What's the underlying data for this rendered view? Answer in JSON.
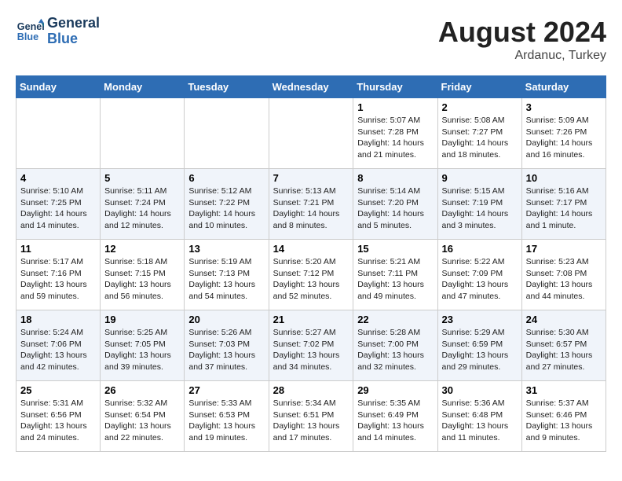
{
  "logo": {
    "line1": "General",
    "line2": "Blue"
  },
  "title": "August 2024",
  "subtitle": "Ardanuc, Turkey",
  "weekdays": [
    "Sunday",
    "Monday",
    "Tuesday",
    "Wednesday",
    "Thursday",
    "Friday",
    "Saturday"
  ],
  "weeks": [
    [
      {
        "day": "",
        "sunrise": "",
        "sunset": "",
        "daylight": ""
      },
      {
        "day": "",
        "sunrise": "",
        "sunset": "",
        "daylight": ""
      },
      {
        "day": "",
        "sunrise": "",
        "sunset": "",
        "daylight": ""
      },
      {
        "day": "",
        "sunrise": "",
        "sunset": "",
        "daylight": ""
      },
      {
        "day": "1",
        "sunrise": "Sunrise: 5:07 AM",
        "sunset": "Sunset: 7:28 PM",
        "daylight": "Daylight: 14 hours and 21 minutes."
      },
      {
        "day": "2",
        "sunrise": "Sunrise: 5:08 AM",
        "sunset": "Sunset: 7:27 PM",
        "daylight": "Daylight: 14 hours and 18 minutes."
      },
      {
        "day": "3",
        "sunrise": "Sunrise: 5:09 AM",
        "sunset": "Sunset: 7:26 PM",
        "daylight": "Daylight: 14 hours and 16 minutes."
      }
    ],
    [
      {
        "day": "4",
        "sunrise": "Sunrise: 5:10 AM",
        "sunset": "Sunset: 7:25 PM",
        "daylight": "Daylight: 14 hours and 14 minutes."
      },
      {
        "day": "5",
        "sunrise": "Sunrise: 5:11 AM",
        "sunset": "Sunset: 7:24 PM",
        "daylight": "Daylight: 14 hours and 12 minutes."
      },
      {
        "day": "6",
        "sunrise": "Sunrise: 5:12 AM",
        "sunset": "Sunset: 7:22 PM",
        "daylight": "Daylight: 14 hours and 10 minutes."
      },
      {
        "day": "7",
        "sunrise": "Sunrise: 5:13 AM",
        "sunset": "Sunset: 7:21 PM",
        "daylight": "Daylight: 14 hours and 8 minutes."
      },
      {
        "day": "8",
        "sunrise": "Sunrise: 5:14 AM",
        "sunset": "Sunset: 7:20 PM",
        "daylight": "Daylight: 14 hours and 5 minutes."
      },
      {
        "day": "9",
        "sunrise": "Sunrise: 5:15 AM",
        "sunset": "Sunset: 7:19 PM",
        "daylight": "Daylight: 14 hours and 3 minutes."
      },
      {
        "day": "10",
        "sunrise": "Sunrise: 5:16 AM",
        "sunset": "Sunset: 7:17 PM",
        "daylight": "Daylight: 14 hours and 1 minute."
      }
    ],
    [
      {
        "day": "11",
        "sunrise": "Sunrise: 5:17 AM",
        "sunset": "Sunset: 7:16 PM",
        "daylight": "Daylight: 13 hours and 59 minutes."
      },
      {
        "day": "12",
        "sunrise": "Sunrise: 5:18 AM",
        "sunset": "Sunset: 7:15 PM",
        "daylight": "Daylight: 13 hours and 56 minutes."
      },
      {
        "day": "13",
        "sunrise": "Sunrise: 5:19 AM",
        "sunset": "Sunset: 7:13 PM",
        "daylight": "Daylight: 13 hours and 54 minutes."
      },
      {
        "day": "14",
        "sunrise": "Sunrise: 5:20 AM",
        "sunset": "Sunset: 7:12 PM",
        "daylight": "Daylight: 13 hours and 52 minutes."
      },
      {
        "day": "15",
        "sunrise": "Sunrise: 5:21 AM",
        "sunset": "Sunset: 7:11 PM",
        "daylight": "Daylight: 13 hours and 49 minutes."
      },
      {
        "day": "16",
        "sunrise": "Sunrise: 5:22 AM",
        "sunset": "Sunset: 7:09 PM",
        "daylight": "Daylight: 13 hours and 47 minutes."
      },
      {
        "day": "17",
        "sunrise": "Sunrise: 5:23 AM",
        "sunset": "Sunset: 7:08 PM",
        "daylight": "Daylight: 13 hours and 44 minutes."
      }
    ],
    [
      {
        "day": "18",
        "sunrise": "Sunrise: 5:24 AM",
        "sunset": "Sunset: 7:06 PM",
        "daylight": "Daylight: 13 hours and 42 minutes."
      },
      {
        "day": "19",
        "sunrise": "Sunrise: 5:25 AM",
        "sunset": "Sunset: 7:05 PM",
        "daylight": "Daylight: 13 hours and 39 minutes."
      },
      {
        "day": "20",
        "sunrise": "Sunrise: 5:26 AM",
        "sunset": "Sunset: 7:03 PM",
        "daylight": "Daylight: 13 hours and 37 minutes."
      },
      {
        "day": "21",
        "sunrise": "Sunrise: 5:27 AM",
        "sunset": "Sunset: 7:02 PM",
        "daylight": "Daylight: 13 hours and 34 minutes."
      },
      {
        "day": "22",
        "sunrise": "Sunrise: 5:28 AM",
        "sunset": "Sunset: 7:00 PM",
        "daylight": "Daylight: 13 hours and 32 minutes."
      },
      {
        "day": "23",
        "sunrise": "Sunrise: 5:29 AM",
        "sunset": "Sunset: 6:59 PM",
        "daylight": "Daylight: 13 hours and 29 minutes."
      },
      {
        "day": "24",
        "sunrise": "Sunrise: 5:30 AM",
        "sunset": "Sunset: 6:57 PM",
        "daylight": "Daylight: 13 hours and 27 minutes."
      }
    ],
    [
      {
        "day": "25",
        "sunrise": "Sunrise: 5:31 AM",
        "sunset": "Sunset: 6:56 PM",
        "daylight": "Daylight: 13 hours and 24 minutes."
      },
      {
        "day": "26",
        "sunrise": "Sunrise: 5:32 AM",
        "sunset": "Sunset: 6:54 PM",
        "daylight": "Daylight: 13 hours and 22 minutes."
      },
      {
        "day": "27",
        "sunrise": "Sunrise: 5:33 AM",
        "sunset": "Sunset: 6:53 PM",
        "daylight": "Daylight: 13 hours and 19 minutes."
      },
      {
        "day": "28",
        "sunrise": "Sunrise: 5:34 AM",
        "sunset": "Sunset: 6:51 PM",
        "daylight": "Daylight: 13 hours and 17 minutes."
      },
      {
        "day": "29",
        "sunrise": "Sunrise: 5:35 AM",
        "sunset": "Sunset: 6:49 PM",
        "daylight": "Daylight: 13 hours and 14 minutes."
      },
      {
        "day": "30",
        "sunrise": "Sunrise: 5:36 AM",
        "sunset": "Sunset: 6:48 PM",
        "daylight": "Daylight: 13 hours and 11 minutes."
      },
      {
        "day": "31",
        "sunrise": "Sunrise: 5:37 AM",
        "sunset": "Sunset: 6:46 PM",
        "daylight": "Daylight: 13 hours and 9 minutes."
      }
    ]
  ]
}
